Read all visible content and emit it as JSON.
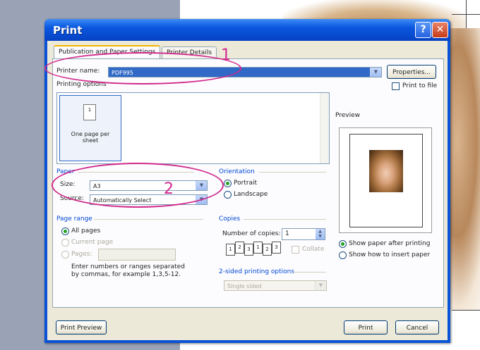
{
  "dialog": {
    "title": "Print",
    "help_glyph": "?",
    "close_glyph": "✕"
  },
  "tabs": [
    {
      "label": "Publication and Paper Settings",
      "active": true
    },
    {
      "label": "Printer Details",
      "active": false
    }
  ],
  "printer": {
    "name_label": "Printer name:",
    "name_value": "PDF995",
    "properties_label": "Properties...",
    "print_to_file_label": "Print to file",
    "printing_options_label": "Printing options"
  },
  "printing_option": {
    "label": "One page per sheet"
  },
  "preview_label": "Preview",
  "paper": {
    "group_label": "Paper",
    "size_label": "Size:",
    "size_value": "A3",
    "source_label": "Source:",
    "source_value": "Automatically Select"
  },
  "orientation": {
    "group_label": "Orientation",
    "portrait": "Portrait",
    "landscape": "Landscape",
    "selected": "portrait"
  },
  "page_range": {
    "group_label": "Page range",
    "all_pages": "All pages",
    "current_page": "Current page",
    "pages": "Pages:",
    "hint": "Enter numbers or ranges separated by commas, for example 1,3,5-12."
  },
  "copies": {
    "group_label": "Copies",
    "number_label": "Number of copies:",
    "number_value": "1",
    "collate_label": "Collate",
    "collate_pages": [
      "1",
      "2",
      "3"
    ]
  },
  "two_sided": {
    "label": "2-sided printing options",
    "value": "Single sided"
  },
  "show_options": {
    "after_printing": "Show paper after printing",
    "how_to_insert": "Show how to insert paper"
  },
  "buttons": {
    "print_preview": "Print Preview",
    "print": "Print",
    "cancel": "Cancel"
  },
  "annotations": {
    "one": "1",
    "two": "2",
    "color": "#d12a8c"
  }
}
